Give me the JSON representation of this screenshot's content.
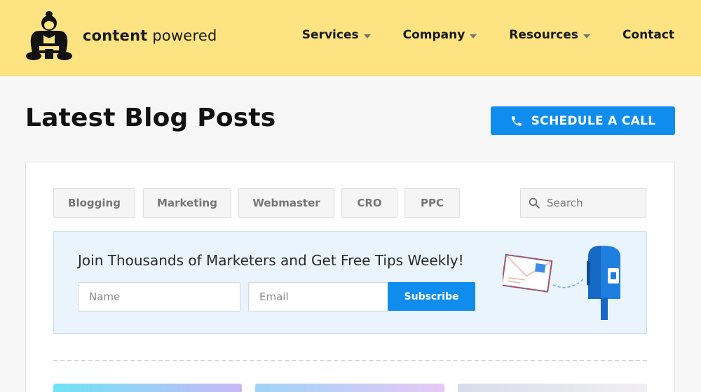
{
  "brand": {
    "name_bold": "content",
    "name_light": "powered"
  },
  "nav": {
    "items": [
      {
        "label": "Services",
        "has_dropdown": true
      },
      {
        "label": "Company",
        "has_dropdown": true
      },
      {
        "label": "Resources",
        "has_dropdown": true
      },
      {
        "label": "Contact",
        "has_dropdown": false
      }
    ]
  },
  "page": {
    "title": "Latest Blog Posts",
    "cta_label": "SCHEDULE A CALL"
  },
  "filters": {
    "categories": [
      "Blogging",
      "Marketing",
      "Webmaster",
      "CRO",
      "PPC"
    ],
    "search_placeholder": "Search"
  },
  "newsletter": {
    "title": "Join Thousands of Marketers and Get Free Tips Weekly!",
    "name_placeholder": "Name",
    "email_placeholder": "Email",
    "subscribe_label": "Subscribe"
  },
  "colors": {
    "header_bg": "#fde381",
    "accent_blue": "#0f8def",
    "promo_bg": "#e9f4fd"
  },
  "icons": {
    "logo": "sumo-wrestler-icon",
    "cta": "phone-icon",
    "search": "search-icon",
    "illustration": "mailbox-envelope-icon"
  }
}
